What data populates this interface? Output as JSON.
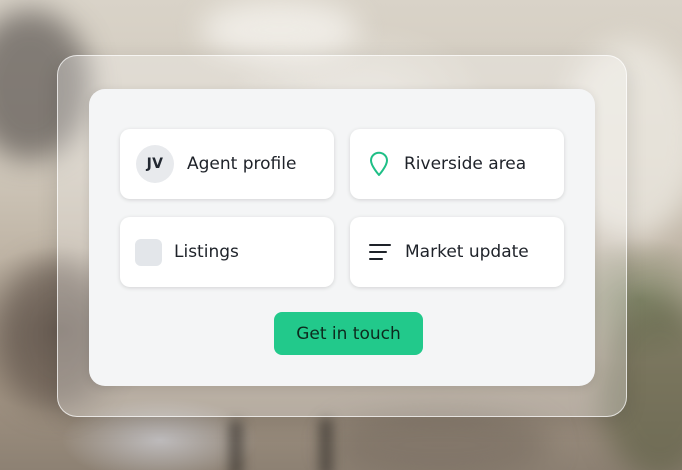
{
  "cards": {
    "agent": {
      "avatar_initials": "JV",
      "label": "Agent profile"
    },
    "area": {
      "icon": "map-pin-icon",
      "label": "Riverside area"
    },
    "listings": {
      "icon": "square-icon",
      "label": "Listings"
    },
    "market": {
      "icon": "menu-lines-icon",
      "label": "Market update"
    }
  },
  "cta": {
    "label": "Get in touch"
  },
  "colors": {
    "accent": "#22c98b",
    "pin": "#1fbf86",
    "panel": "#f4f5f6",
    "text": "#1e2229"
  }
}
